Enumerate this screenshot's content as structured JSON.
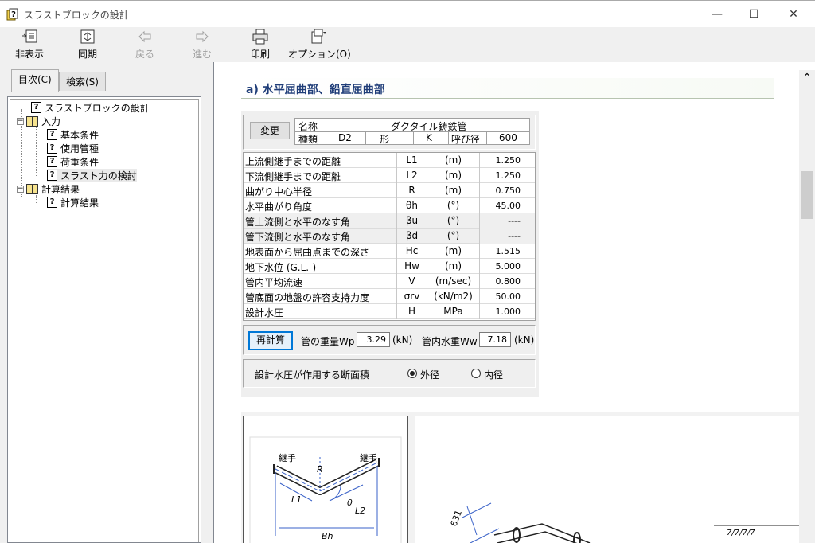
{
  "window": {
    "title": "スラストブロックの設計",
    "controls": {
      "minimize": "—",
      "maximize": "☐",
      "close": "✕"
    }
  },
  "toolbar": {
    "hide": "非表示",
    "sync": "同期",
    "back": "戻る",
    "forward": "進む",
    "print": "印刷",
    "options": "オプション(O)"
  },
  "nav_tabs": {
    "contents": "目次(C)",
    "search": "検索(S)"
  },
  "tree": {
    "root": "スラストブロックの設計",
    "input": "入力",
    "input_children": [
      "基本条件",
      "使用管種",
      "荷重条件",
      "スラスト力の検討"
    ],
    "results": "計算結果",
    "results_children": [
      "計算結果"
    ]
  },
  "section": {
    "heading": "a) 水平屈曲部、鉛直屈曲部"
  },
  "pipe_header": {
    "change_button": "変更",
    "name_label": "名称",
    "name_value": "ダクタイル鋳鉄管",
    "kind_label": "種類",
    "kind_value": "D2",
    "shape_label": "形",
    "shape_value": "K",
    "nominal_label": "呼び径",
    "nominal_value": "600"
  },
  "params": [
    {
      "name": "上流側継手までの距離",
      "symbol": "L1",
      "unit": "(m)",
      "value": "1.250",
      "shaded": false
    },
    {
      "name": "下流側継手までの距離",
      "symbol": "L2",
      "unit": "(m)",
      "value": "1.250",
      "shaded": false
    },
    {
      "name": "曲がり中心半径",
      "symbol": "R",
      "unit": "(m)",
      "value": "0.750",
      "shaded": false
    },
    {
      "name": "水平曲がり角度",
      "symbol": "θh",
      "unit": "(°)",
      "value": "45.00",
      "shaded": false
    },
    {
      "name": "管上流側と水平のなす角",
      "symbol": "βu",
      "unit": "(°)",
      "value": "----",
      "shaded": true
    },
    {
      "name": "管下流側と水平のなす角",
      "symbol": "βd",
      "unit": "(°)",
      "value": "----",
      "shaded": true
    },
    {
      "name": "地表面から屈曲点までの深さ",
      "symbol": "Hc",
      "unit": "(m)",
      "value": "1.515",
      "shaded": false
    },
    {
      "name": "地下水位 (G.L.-)",
      "symbol": "Hw",
      "unit": "(m)",
      "value": "5.000",
      "shaded": false
    },
    {
      "name": "管内平均流速",
      "symbol": "V",
      "unit": "(m/sec)",
      "value": "0.800",
      "shaded": false
    },
    {
      "name": "管底面の地盤の許容支持力度",
      "symbol": "σrv",
      "unit": "(kN/m2)",
      "value": "50.00",
      "shaded": false
    },
    {
      "name": "設計水圧",
      "symbol": "H",
      "unit": "MPa",
      "value": "1.000",
      "shaded": false
    }
  ],
  "recalc": {
    "button": "再計算",
    "pipe_weight_label": "管の重量Wp",
    "pipe_weight_value": "3.29",
    "pipe_weight_unit": "(kN)",
    "water_weight_label": "管内水重Ww",
    "water_weight_value": "7.18",
    "water_weight_unit": "(kN)"
  },
  "pressure_area": {
    "label": "設計水圧が作用する断面積",
    "options": [
      "外径",
      "内径"
    ],
    "selected": "外径"
  },
  "diagram1": {
    "joint_left": "継手",
    "joint_right": "継手",
    "radius": "R",
    "theta": "θ",
    "l1": "L1",
    "l2": "L2",
    "bh": "Bh"
  },
  "diagram2": {
    "dimension": "631",
    "slope_mark": "7/7/7/7"
  }
}
